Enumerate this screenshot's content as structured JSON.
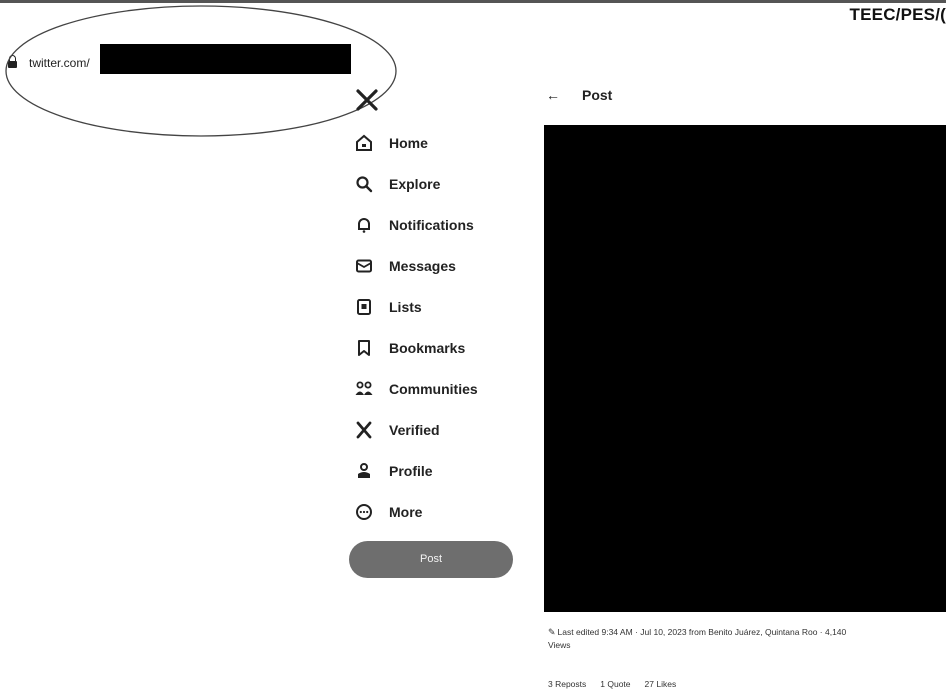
{
  "header": {
    "doc_code": "TEEC/PES/("
  },
  "browser": {
    "url_prefix": "twitter.com/"
  },
  "nav": {
    "items": [
      {
        "label": "Home",
        "icon": "home-icon"
      },
      {
        "label": "Explore",
        "icon": "search-icon"
      },
      {
        "label": "Notifications",
        "icon": "bell-icon"
      },
      {
        "label": "Messages",
        "icon": "envelope-icon"
      },
      {
        "label": "Lists",
        "icon": "list-icon"
      },
      {
        "label": "Bookmarks",
        "icon": "bookmark-icon"
      },
      {
        "label": "Communities",
        "icon": "people-icon"
      },
      {
        "label": "Verified",
        "icon": "x-logo-icon"
      },
      {
        "label": "Profile",
        "icon": "person-icon"
      },
      {
        "label": "More",
        "icon": "more-icon"
      }
    ],
    "post_button": "Post"
  },
  "post": {
    "title": "Post",
    "meta": "Last edited 9:34 AM · Jul 10, 2023 from Benito Juárez, Quintana Roo · 4,140",
    "views_label": "Views",
    "stats": {
      "reposts": "3 Reposts",
      "quotes": "1 Quote",
      "likes": "27 Likes"
    }
  }
}
